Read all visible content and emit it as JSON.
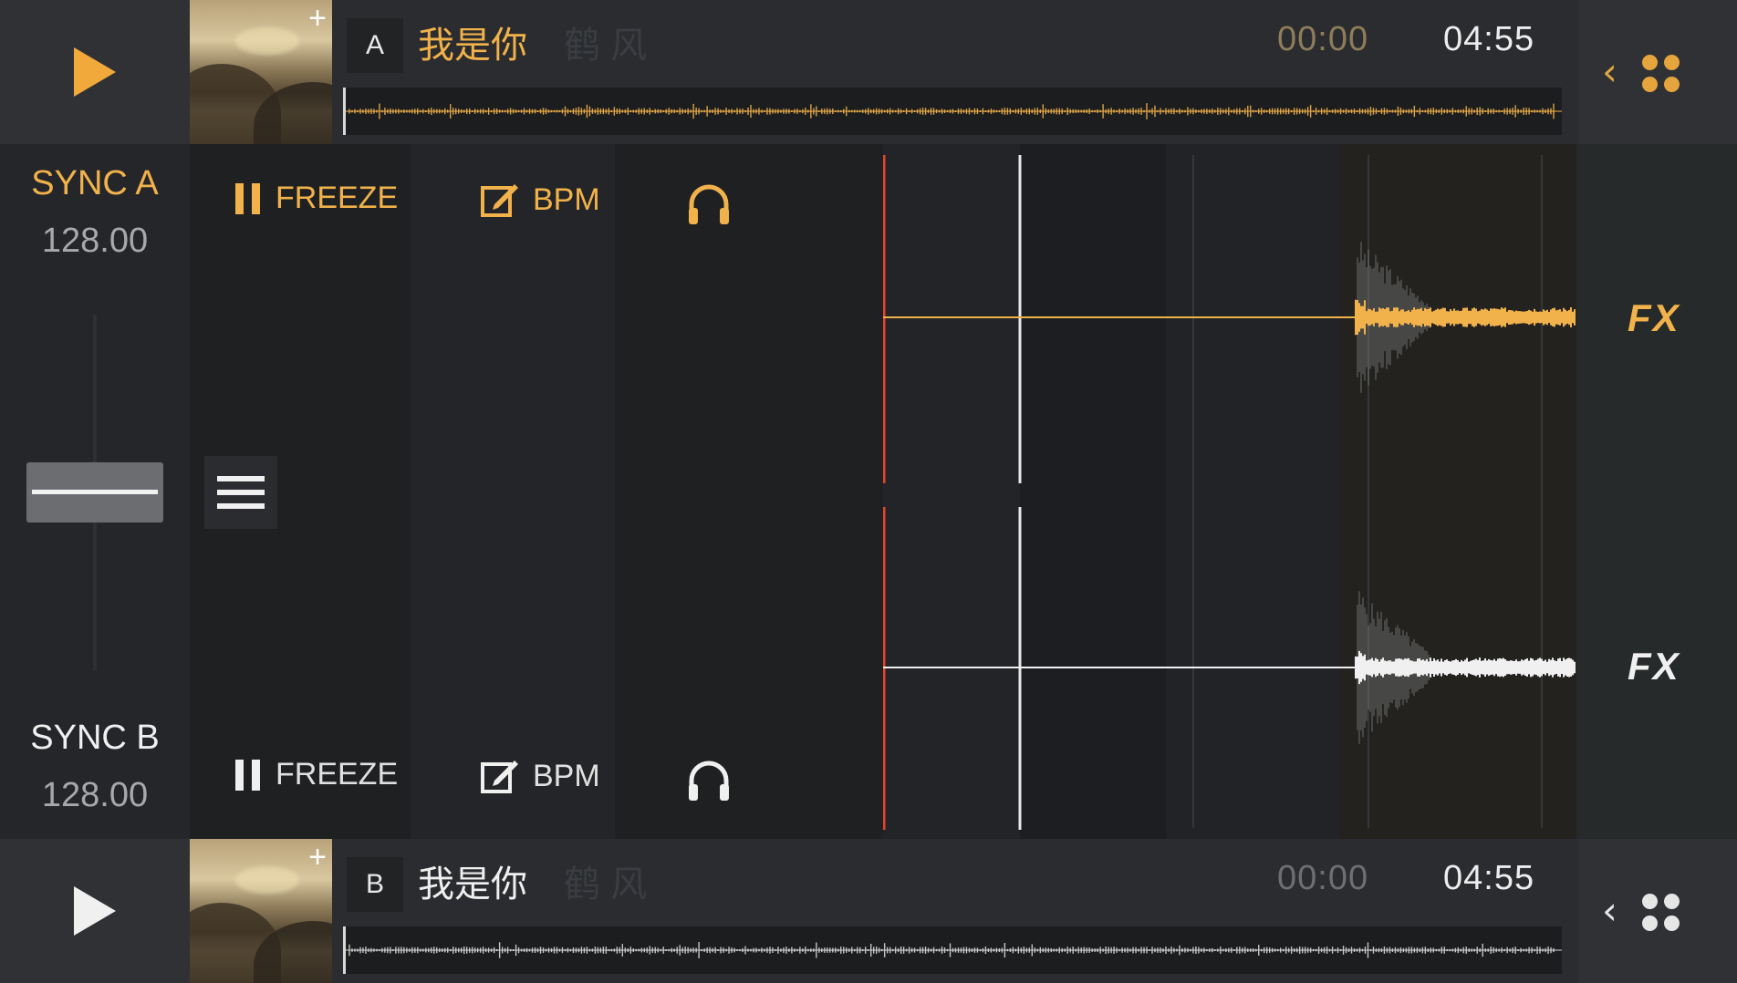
{
  "decks": [
    {
      "id": "a",
      "letter": "A",
      "title": "我是你",
      "ghost_text": "鹤 风",
      "elapsed": "00:00",
      "total": "04:55",
      "accent": "#f2b24b"
    },
    {
      "id": "b",
      "letter": "B",
      "title": "我是你",
      "ghost_text": "鹤 风",
      "elapsed": "00:00",
      "total": "04:55",
      "accent": "#f0f0f0"
    }
  ],
  "sync_a": {
    "label": "SYNC A",
    "bpm": "128.00"
  },
  "sync_b": {
    "label": "SYNC B",
    "bpm": "128.00"
  },
  "controls": {
    "freeze_label": "FREEZE",
    "bpm_label": "BPM"
  },
  "fx_label": "FX",
  "colors": {
    "accent_orange": "#f2b24b",
    "playhead_red": "#e8432a",
    "background": "#1d1e20"
  },
  "icons": {
    "play": "play-icon",
    "add": "plus-icon",
    "pause": "pause-icon",
    "edit": "edit-icon",
    "headphones": "headphones-icon",
    "menu": "hamburger-menu-icon",
    "back": "chevron-left-icon",
    "grid": "dots-grid-icon"
  }
}
